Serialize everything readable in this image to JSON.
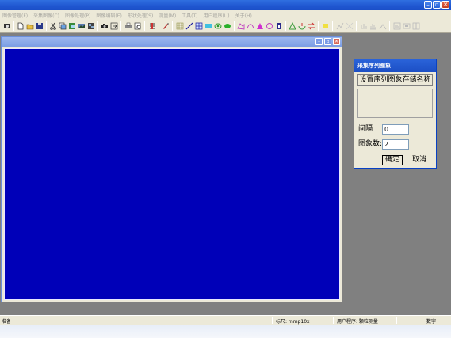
{
  "app": {
    "window_controls": {
      "minimize": "–",
      "maximize": "▫",
      "close": "✕"
    }
  },
  "menu": {
    "items": [
      "图像管理(F)",
      "采集图像(C)",
      "图像处理(P)",
      "图像编辑(E)",
      "形状处理(S)",
      "测量(M)",
      "工具(T)",
      "用户程序(U)",
      "关于(H)"
    ]
  },
  "toolbar": {
    "icons": [
      "capture-icon",
      "new-file-icon",
      "open-folder-icon",
      "save-icon",
      "cut-icon",
      "copy-image-icon",
      "paste-image-icon",
      "compare-icon",
      "sequence-icon",
      "camera-icon",
      "export-icon",
      "print-icon",
      "print-preview-icon",
      "adjust-icon",
      "brush-icon",
      "grid-icon",
      "line-icon",
      "table-icon",
      "rectangle-icon",
      "ellipse-icon",
      "fill-icon",
      "polygon-icon",
      "curve-icon",
      "triangle-icon",
      "circle-tool-icon",
      "bracket-icon",
      "star-icon",
      "measure-icon",
      "ruler-icon",
      "scale-icon",
      "graph-icon",
      "zoom-icon",
      "layout-icon"
    ]
  },
  "image_window": {
    "controls": {
      "minimize": "–",
      "maximize": "▫",
      "close": "✕"
    },
    "canvas_color": "#0000b8"
  },
  "dialog": {
    "title": "采集序列图象",
    "set_name_button": "设置序列图象存储名称",
    "interval_label": "间隔",
    "interval_value": "0",
    "count_label": "图象数:",
    "count_value": "2",
    "ok_button": "确定",
    "cancel_button": "取消"
  },
  "status": {
    "left": "准备",
    "scale": "标尺: mmp10x",
    "user_program": "用户程序: 颗粒测量",
    "mode": "数字"
  }
}
